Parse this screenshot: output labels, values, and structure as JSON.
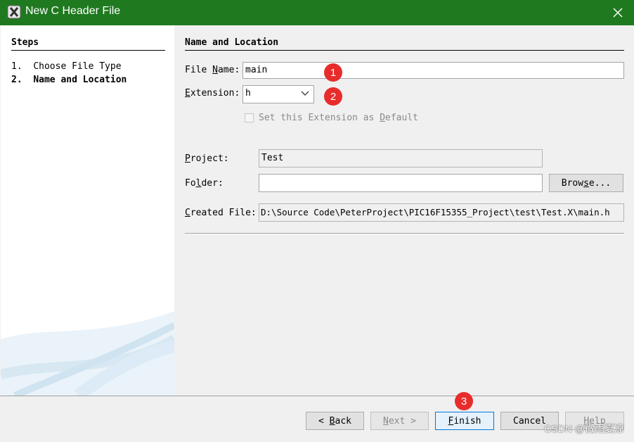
{
  "window": {
    "title": "New C Header File",
    "icon": "netbeans-x-icon",
    "close_icon": "close-icon"
  },
  "steps": {
    "title": "Steps",
    "items": [
      {
        "number": "1.",
        "label": "Choose File Type"
      },
      {
        "number": "2.",
        "label": "Name and Location"
      }
    ]
  },
  "panel": {
    "title": "Name and Location",
    "file_name": {
      "label_pre": "File ",
      "label_mn": "N",
      "label_post": "ame:",
      "value": "main"
    },
    "extension": {
      "label_mn": "E",
      "label_post": "xtension:",
      "value": "h"
    },
    "set_default": {
      "label_pre": "Set this Extension as ",
      "label_mn": "D",
      "label_post": "efault",
      "checked": false
    },
    "project": {
      "label_mn": "P",
      "label_post": "roject:",
      "value": "Test"
    },
    "folder": {
      "label_pre": "Fo",
      "label_mn": "l",
      "label_post": "der:",
      "value": ""
    },
    "browse": {
      "pre": "Brow",
      "mn": "s",
      "post": "e..."
    },
    "created_file": {
      "label_mn": "C",
      "label_post": "reated File:",
      "value": "D:\\Source Code\\PeterProject\\PIC16F15355_Project\\test\\Test.X\\main.h"
    }
  },
  "footer": {
    "back": {
      "arrow": "<",
      "mn": "B",
      "post": "ack"
    },
    "next": {
      "mn": "N",
      "post": "ext",
      "arrow": ">"
    },
    "finish": {
      "mn": "F",
      "post": "inish"
    },
    "cancel": {
      "label": "Cancel"
    },
    "help": {
      "mn": "H",
      "post": "elp"
    }
  },
  "annotations": [
    "1",
    "2",
    "3"
  ],
  "watermark": "CSDN @微雨夏凉",
  "colors": {
    "titlebar": "#1f7a1f",
    "badge": "#e82c2c",
    "primary_border": "#0078d7"
  }
}
